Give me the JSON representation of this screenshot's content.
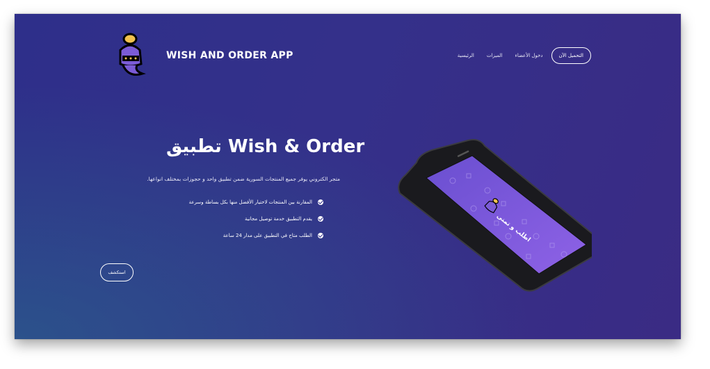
{
  "brand": {
    "name": "WISH AND ORDER APP"
  },
  "nav": {
    "download_button": "التحميل الآن",
    "links": [
      "دخول الأعضاء",
      "الميزات",
      "الرئيسية"
    ]
  },
  "hero": {
    "title": "تطبيق Wish & Order",
    "description": "متجر الكتروني يوفر جميع المنتجات السورية ضمن تطبيق واحد و حجوزات بمختلف انواعها.",
    "features": [
      "المقارنة بين المنتجات لاختيار الأفضل منها بكل بساطة وسرعة",
      "يقدم التطبيق خدمة توصيل مجانية",
      "الطلب متاح في التطبيق على مدار 24 ساعة"
    ],
    "discover_button": "استكشف"
  },
  "phone_screen": {
    "text": "اطلب و تمنى"
  },
  "colors": {
    "background": "#34308a",
    "accent": "#7b5bd6",
    "logo_gold": "#f2c14e"
  },
  "icons": [
    "genie-logo-icon",
    "check-circle-icon",
    "phone-mockup"
  ]
}
